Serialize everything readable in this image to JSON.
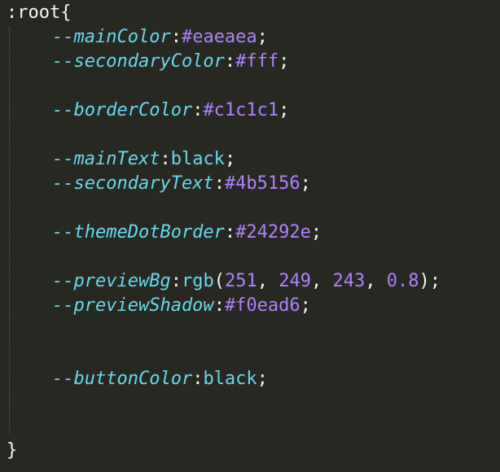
{
  "editor": {
    "selector": ":root",
    "open_brace": "{",
    "close_brace": "}",
    "declarations": [
      {
        "property": "--mainColor",
        "value": "#eaeaea"
      },
      {
        "property": "--secondaryColor",
        "value": "#fff"
      },
      {
        "property": "--borderColor",
        "value": "#c1c1c1"
      },
      {
        "property": "--mainText",
        "value": "black"
      },
      {
        "property": "--secondaryText",
        "value": "#4b5156"
      },
      {
        "property": "--themeDotBorder",
        "value": "#24292e"
      },
      {
        "property": "--previewBg",
        "fn": "rgb",
        "args": [
          "251",
          "249",
          "243",
          "0.8"
        ]
      },
      {
        "property": "--previewShadow",
        "value": "#f0ead6"
      },
      {
        "property": "--buttonColor",
        "value": "black"
      }
    ],
    "colors": {
      "background": "#272822",
      "property": "#66d9ef",
      "literal": "#ae81ff",
      "text": "#f8f8f2"
    }
  }
}
